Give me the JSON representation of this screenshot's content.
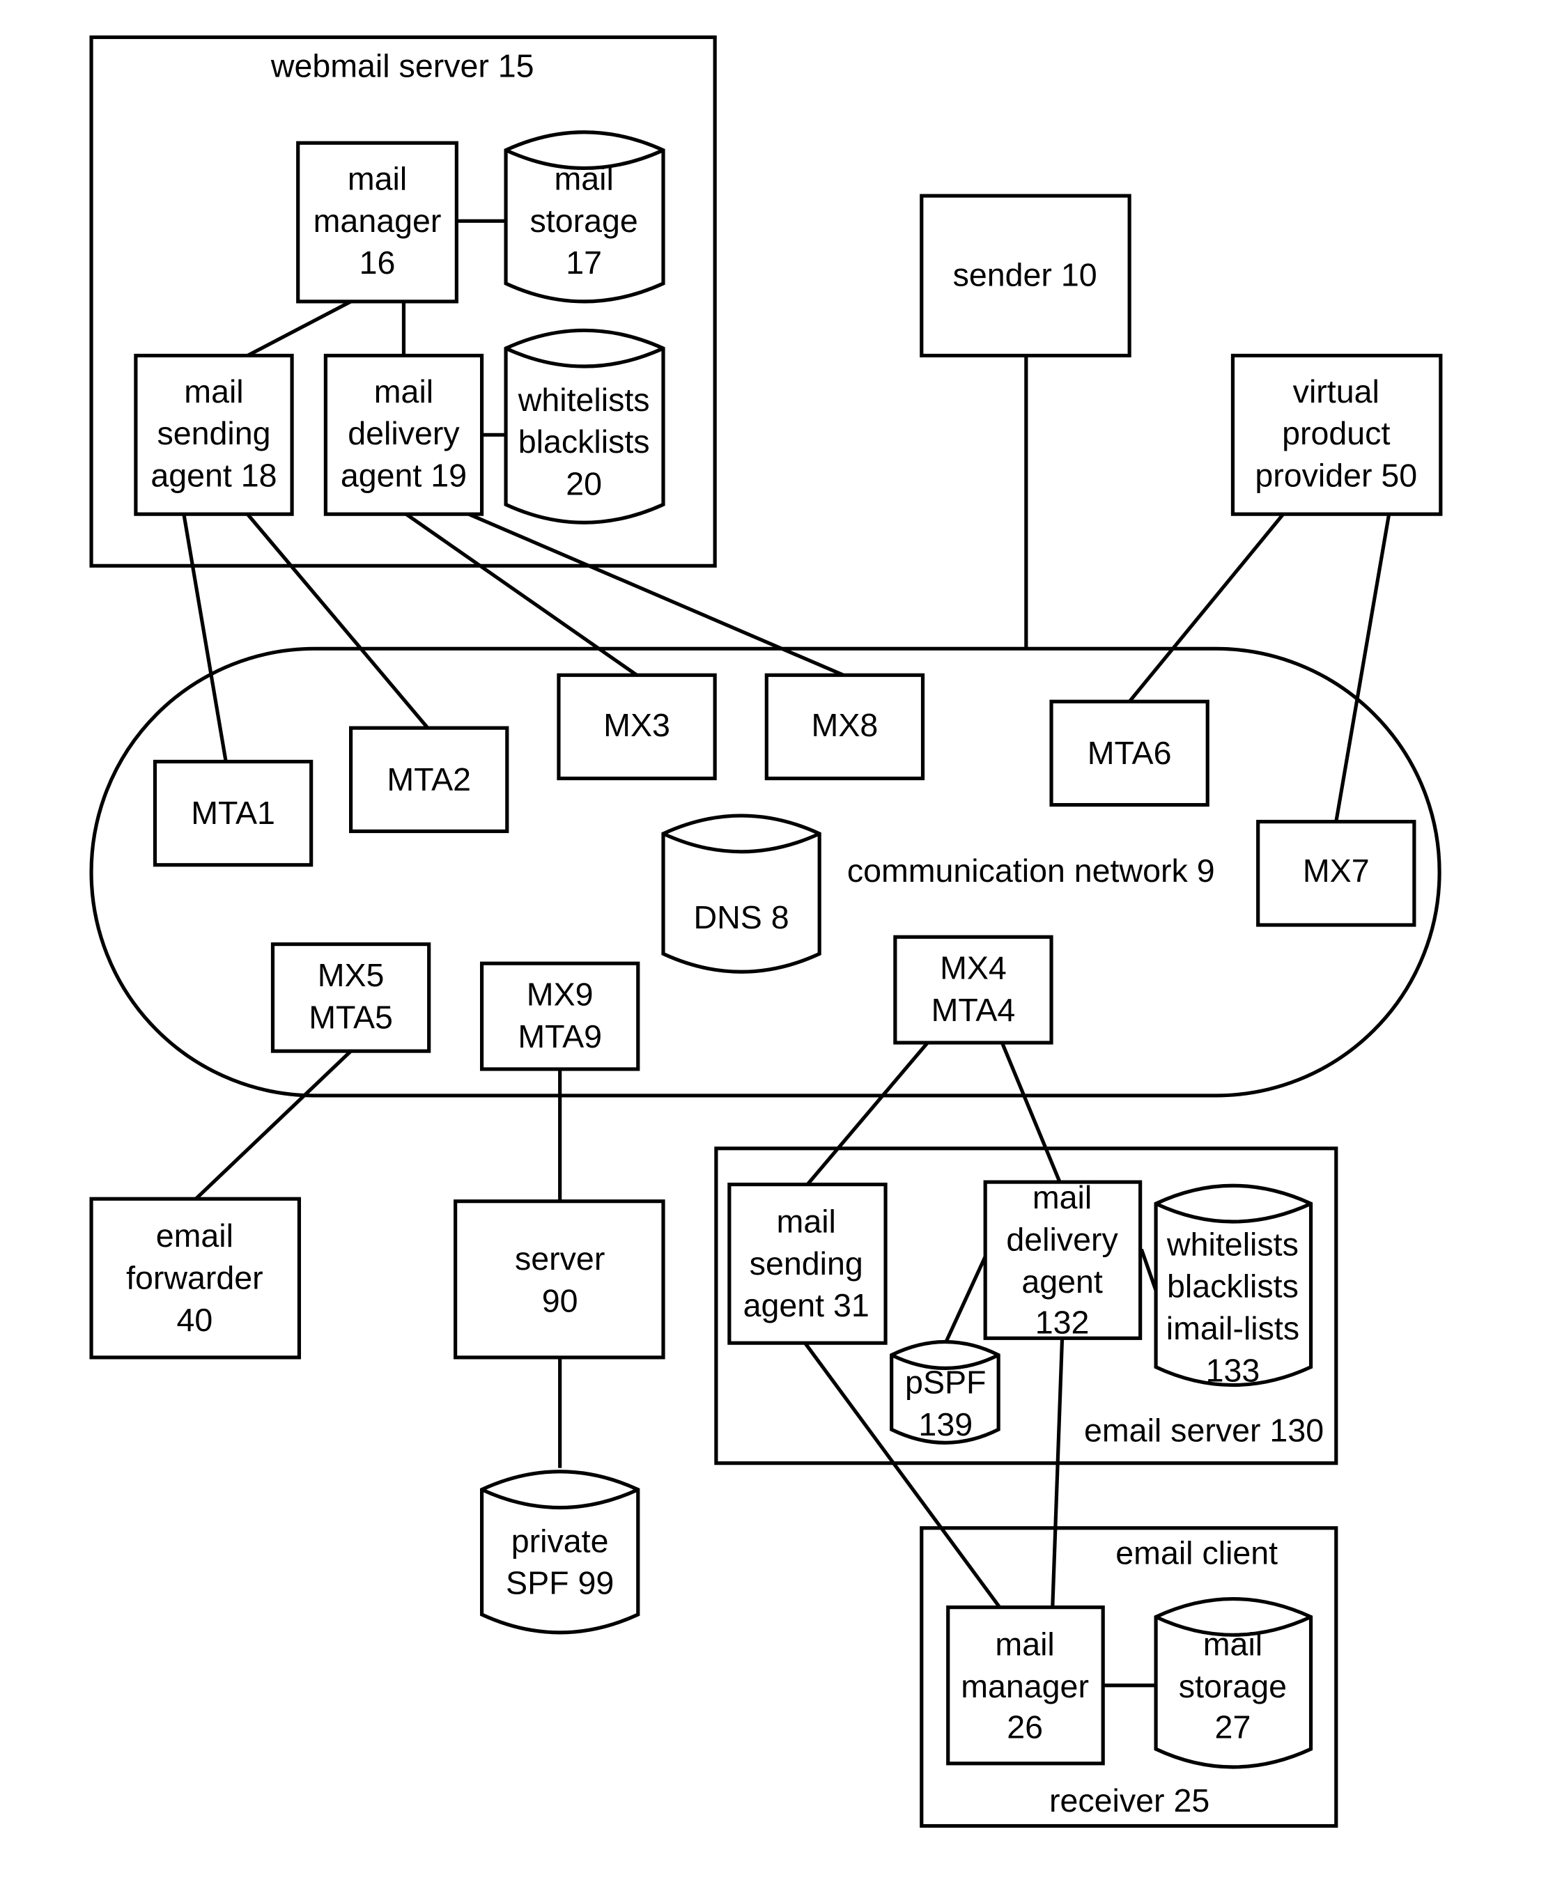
{
  "diagram": {
    "containers": {
      "webmail_server": "webmail server 15",
      "network": "communication network 9",
      "email_server": "email server 130",
      "email_client": "email client",
      "receiver": "receiver 25"
    },
    "nodes": {
      "mail_manager_16": [
        "mail",
        "manager",
        "16"
      ],
      "mail_storage_17": [
        "mail",
        "storage",
        "17"
      ],
      "mail_sending_agent_18": [
        "mail",
        "sending",
        "agent 18"
      ],
      "mail_delivery_agent_19": [
        "mail",
        "delivery",
        "agent 19"
      ],
      "lists_20": [
        "whitelists",
        "blacklists",
        "20"
      ],
      "sender_10": [
        "sender 10"
      ],
      "vpp_50": [
        "virtual",
        "product",
        "provider 50"
      ],
      "mta1": [
        "MTA1"
      ],
      "mta2": [
        "MTA2"
      ],
      "mx3": [
        "MX3"
      ],
      "mx8": [
        "MX8"
      ],
      "mta6": [
        "MTA6"
      ],
      "mx7": [
        "MX7"
      ],
      "dns8": [
        "DNS 8"
      ],
      "mx5": [
        "MX5",
        "MTA5"
      ],
      "mx9": [
        "MX9",
        "MTA9"
      ],
      "mx4": [
        "MX4",
        "MTA4"
      ],
      "email_forwarder_40": [
        "email",
        "forwarder",
        "40"
      ],
      "server_90": [
        "server",
        "90"
      ],
      "private_spf_99": [
        "private",
        "SPF 99"
      ],
      "mail_sending_agent_31": [
        "mail",
        "sending",
        "agent 31"
      ],
      "mail_delivery_agent_132": [
        "mail",
        "delivery",
        "agent",
        "132"
      ],
      "pspf_139": [
        "pSPF",
        "139"
      ],
      "lists_133": [
        "whitelists",
        "blacklists",
        "imail-lists",
        "133"
      ],
      "mail_manager_26": [
        "mail",
        "manager",
        "26"
      ],
      "mail_storage_27": [
        "mail",
        "storage",
        "27"
      ]
    }
  }
}
